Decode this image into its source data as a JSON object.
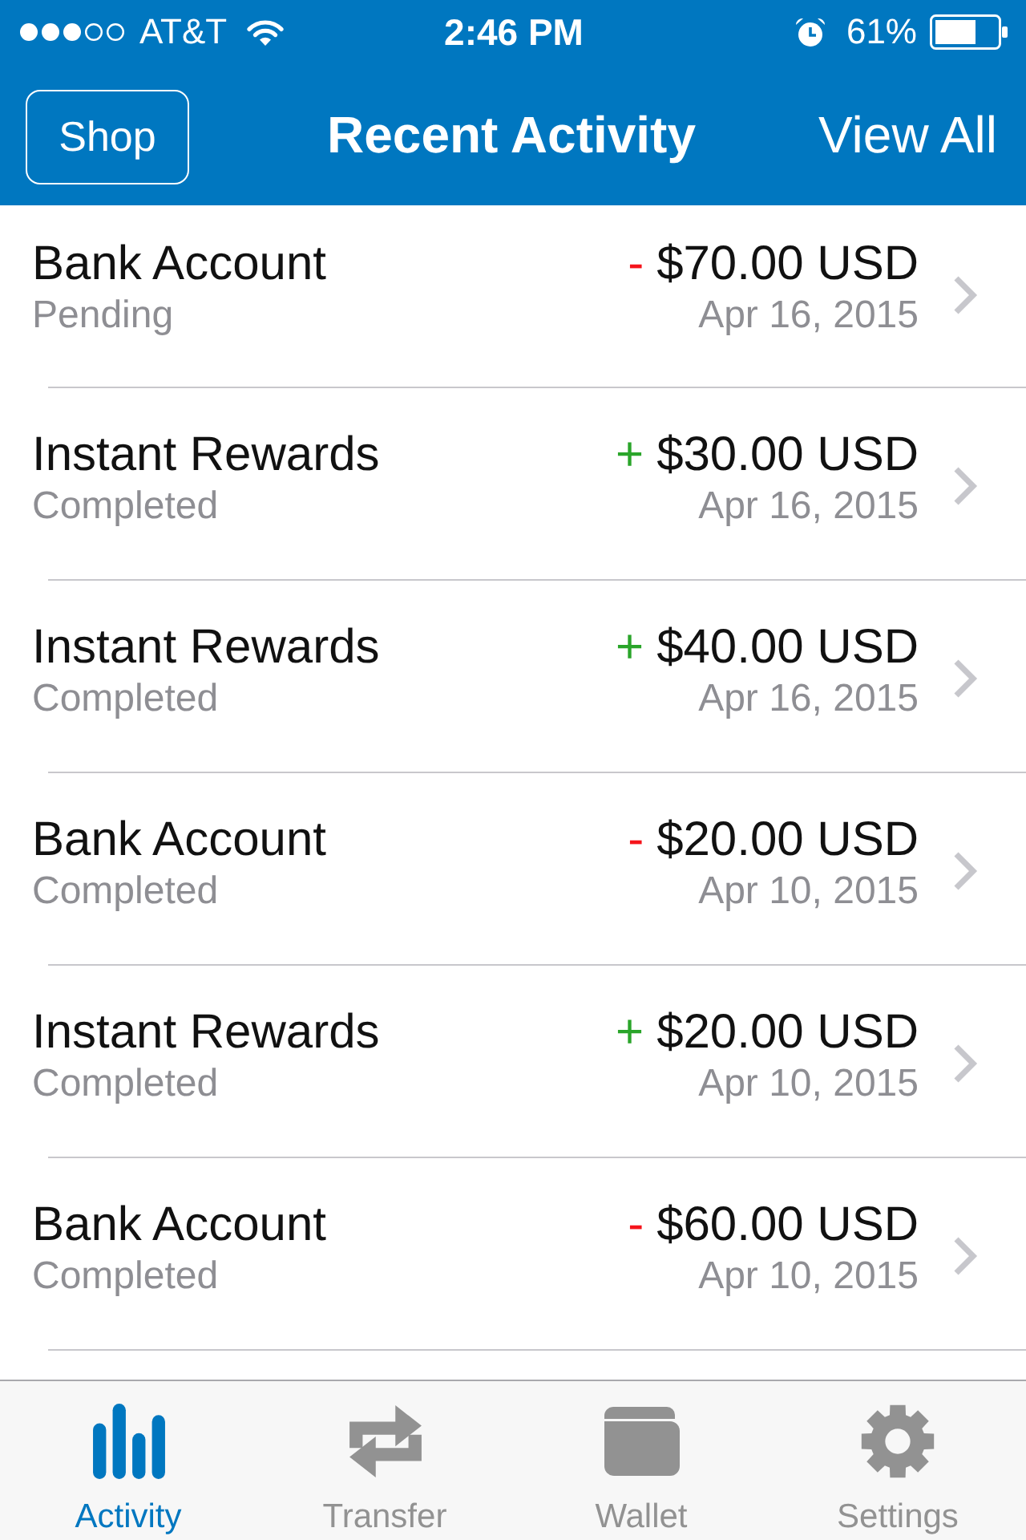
{
  "status_bar": {
    "carrier": "AT&T",
    "time": "2:46 PM",
    "battery": "61%"
  },
  "nav_bar": {
    "left_button": "Shop",
    "title": "Recent Activity",
    "right_button": "View All"
  },
  "transactions": [
    {
      "name": "Bank Account",
      "status": "Pending",
      "kind": "debit",
      "sign": "-",
      "amount": "$70.00 USD",
      "date": "Apr 16, 2015"
    },
    {
      "name": "Instant Rewards",
      "status": "Completed",
      "kind": "credit",
      "sign": "+",
      "amount": "$30.00 USD",
      "date": "Apr 16, 2015"
    },
    {
      "name": "Instant Rewards",
      "status": "Completed",
      "kind": "credit",
      "sign": "+",
      "amount": "$40.00 USD",
      "date": "Apr 16, 2015"
    },
    {
      "name": "Bank Account",
      "status": "Completed",
      "kind": "debit",
      "sign": "-",
      "amount": "$20.00 USD",
      "date": "Apr 10, 2015"
    },
    {
      "name": "Instant Rewards",
      "status": "Completed",
      "kind": "credit",
      "sign": "+",
      "amount": "$20.00 USD",
      "date": "Apr 10, 2015"
    },
    {
      "name": "Bank Account",
      "status": "Completed",
      "kind": "debit",
      "sign": "-",
      "amount": "$60.00 USD",
      "date": "Apr 10, 2015"
    }
  ],
  "tab_bar": [
    {
      "label": "Activity",
      "selected": true
    },
    {
      "label": "Transfer",
      "selected": false
    },
    {
      "label": "Wallet",
      "selected": false
    },
    {
      "label": "Settings",
      "selected": false
    }
  ]
}
